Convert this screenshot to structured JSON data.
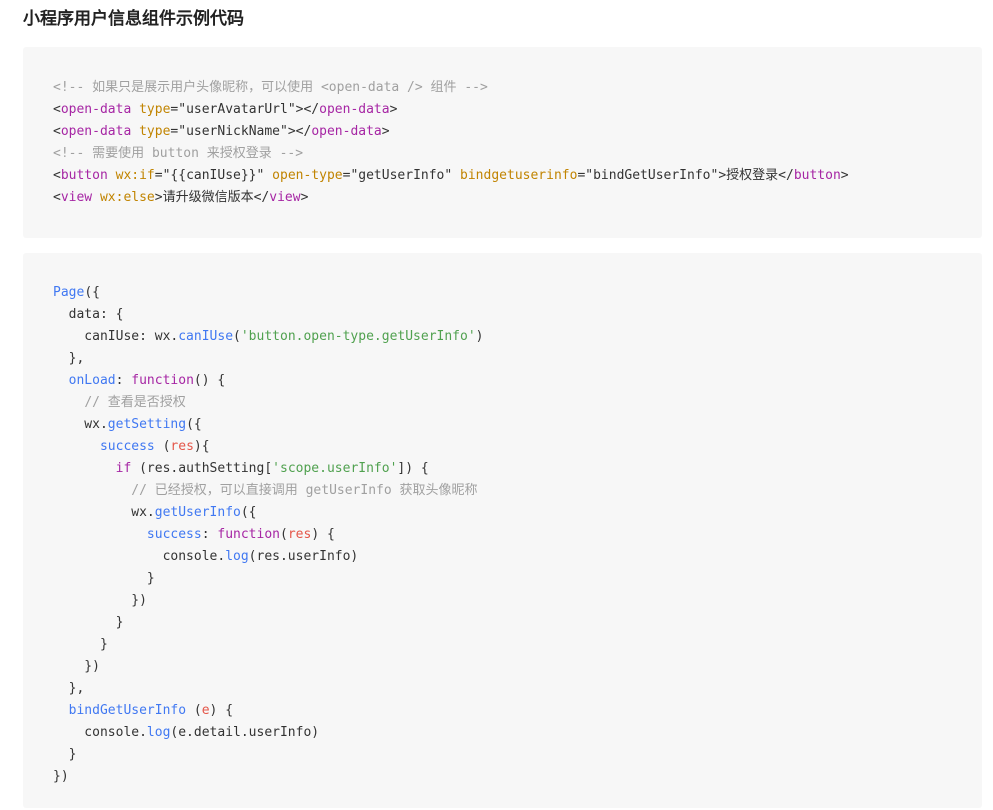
{
  "page": {
    "title": "小程序用户信息组件示例代码"
  },
  "code_blocks": [
    {
      "language": "wxml",
      "lines": [
        [
          {
            "t": "comment",
            "v": "<!-- 如果只是展示用户头像昵称，可以使用 <open-data /> 组件 -->"
          }
        ],
        [
          {
            "t": "plain",
            "v": "<"
          },
          {
            "t": "tag",
            "v": "open-data"
          },
          {
            "t": "plain",
            "v": " "
          },
          {
            "t": "attr",
            "v": "type"
          },
          {
            "t": "plain",
            "v": "=\"userAvatarUrl\"></"
          },
          {
            "t": "tag",
            "v": "open-data"
          },
          {
            "t": "plain",
            "v": ">"
          }
        ],
        [
          {
            "t": "plain",
            "v": "<"
          },
          {
            "t": "tag",
            "v": "open-data"
          },
          {
            "t": "plain",
            "v": " "
          },
          {
            "t": "attr",
            "v": "type"
          },
          {
            "t": "plain",
            "v": "=\"userNickName\"></"
          },
          {
            "t": "tag",
            "v": "open-data"
          },
          {
            "t": "plain",
            "v": ">"
          }
        ],
        [
          {
            "t": "comment",
            "v": "<!-- 需要使用 button 来授权登录 -->"
          }
        ],
        [
          {
            "t": "plain",
            "v": "<"
          },
          {
            "t": "tag",
            "v": "button"
          },
          {
            "t": "plain",
            "v": " "
          },
          {
            "t": "attr",
            "v": "wx:if"
          },
          {
            "t": "plain",
            "v": "=\"{{canIUse}}\" "
          },
          {
            "t": "attr",
            "v": "open-type"
          },
          {
            "t": "plain",
            "v": "=\"getUserInfo\" "
          },
          {
            "t": "attr",
            "v": "bindgetuserinfo"
          },
          {
            "t": "plain",
            "v": "=\"bindGetUserInfo\">授权登录</"
          },
          {
            "t": "tag",
            "v": "button"
          },
          {
            "t": "plain",
            "v": ">"
          }
        ],
        [
          {
            "t": "plain",
            "v": "<"
          },
          {
            "t": "tag",
            "v": "view"
          },
          {
            "t": "plain",
            "v": " "
          },
          {
            "t": "attr",
            "v": "wx:else"
          },
          {
            "t": "plain",
            "v": ">请升级微信版本</"
          },
          {
            "t": "tag",
            "v": "view"
          },
          {
            "t": "plain",
            "v": ">"
          }
        ]
      ]
    },
    {
      "language": "javascript",
      "lines": [
        [
          {
            "t": "fn",
            "v": "Page"
          },
          {
            "t": "plain",
            "v": "({"
          }
        ],
        [
          {
            "t": "plain",
            "v": "  data: {"
          }
        ],
        [
          {
            "t": "plain",
            "v": "    canIUse: wx."
          },
          {
            "t": "fn",
            "v": "canIUse"
          },
          {
            "t": "plain",
            "v": "("
          },
          {
            "t": "string",
            "v": "'button.open-type.getUserInfo'"
          },
          {
            "t": "plain",
            "v": ")"
          }
        ],
        [
          {
            "t": "plain",
            "v": "  },"
          }
        ],
        [
          {
            "t": "plain",
            "v": "  "
          },
          {
            "t": "prop",
            "v": "onLoad"
          },
          {
            "t": "plain",
            "v": ": "
          },
          {
            "t": "keyword",
            "v": "function"
          },
          {
            "t": "plain",
            "v": "() {"
          }
        ],
        [
          {
            "t": "plain",
            "v": "    "
          },
          {
            "t": "comment",
            "v": "// 查看是否授权"
          }
        ],
        [
          {
            "t": "plain",
            "v": "    wx."
          },
          {
            "t": "fn",
            "v": "getSetting"
          },
          {
            "t": "plain",
            "v": "({"
          }
        ],
        [
          {
            "t": "plain",
            "v": "      "
          },
          {
            "t": "prop",
            "v": "success"
          },
          {
            "t": "plain",
            "v": " ("
          },
          {
            "t": "param",
            "v": "res"
          },
          {
            "t": "plain",
            "v": "){"
          }
        ],
        [
          {
            "t": "plain",
            "v": "        "
          },
          {
            "t": "keyword",
            "v": "if"
          },
          {
            "t": "plain",
            "v": " (res.authSetting["
          },
          {
            "t": "string",
            "v": "'scope.userInfo'"
          },
          {
            "t": "plain",
            "v": "]) {"
          }
        ],
        [
          {
            "t": "plain",
            "v": "          "
          },
          {
            "t": "comment",
            "v": "// 已经授权，可以直接调用 getUserInfo 获取头像昵称"
          }
        ],
        [
          {
            "t": "plain",
            "v": "          wx."
          },
          {
            "t": "fn",
            "v": "getUserInfo"
          },
          {
            "t": "plain",
            "v": "({"
          }
        ],
        [
          {
            "t": "plain",
            "v": "            "
          },
          {
            "t": "prop",
            "v": "success"
          },
          {
            "t": "plain",
            "v": ": "
          },
          {
            "t": "keyword",
            "v": "function"
          },
          {
            "t": "plain",
            "v": "("
          },
          {
            "t": "param",
            "v": "res"
          },
          {
            "t": "plain",
            "v": ") {"
          }
        ],
        [
          {
            "t": "plain",
            "v": "              console."
          },
          {
            "t": "fn",
            "v": "log"
          },
          {
            "t": "plain",
            "v": "(res.userInfo)"
          }
        ],
        [
          {
            "t": "plain",
            "v": "            }"
          }
        ],
        [
          {
            "t": "plain",
            "v": "          })"
          }
        ],
        [
          {
            "t": "plain",
            "v": "        }"
          }
        ],
        [
          {
            "t": "plain",
            "v": "      }"
          }
        ],
        [
          {
            "t": "plain",
            "v": "    })"
          }
        ],
        [
          {
            "t": "plain",
            "v": "  },"
          }
        ],
        [
          {
            "t": "plain",
            "v": "  "
          },
          {
            "t": "prop",
            "v": "bindGetUserInfo"
          },
          {
            "t": "plain",
            "v": " ("
          },
          {
            "t": "param",
            "v": "e"
          },
          {
            "t": "plain",
            "v": ") {"
          }
        ],
        [
          {
            "t": "plain",
            "v": "    console."
          },
          {
            "t": "fn",
            "v": "log"
          },
          {
            "t": "plain",
            "v": "(e.detail.userInfo)"
          }
        ],
        [
          {
            "t": "plain",
            "v": "  }"
          }
        ],
        [
          {
            "t": "plain",
            "v": "})"
          }
        ]
      ]
    }
  ]
}
